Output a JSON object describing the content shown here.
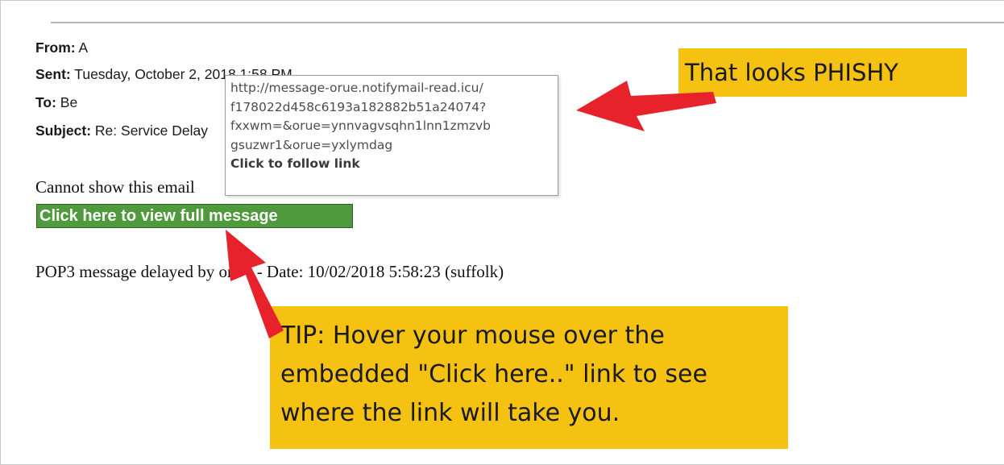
{
  "email": {
    "header": {
      "from_label": "From:",
      "from_value": "A",
      "sent_label": "Sent:",
      "sent_value": "Tuesday, October 2, 2018 1:58 PM",
      "to_label": "To:",
      "to_value": "Be",
      "subject_label": "Subject:",
      "subject_value": "Re: Service Delay"
    },
    "body_notice": "Cannot show this email",
    "link_label": "Click here to view full message",
    "footer_line": "POP3 message delayed by orUe - Date: 10/02/2018 5:58:23 (suffolk)"
  },
  "tooltip": {
    "url_lines": [
      "http://message-orue.notifymail-read.icu/",
      "f178022d458c6193a182882b51a24074?",
      "fxxwm=&orue=ynnvagvsqhn1lnn1zmzvb",
      "gsuzwr1&orue=yxlymdag"
    ],
    "follow_text": "Click to follow link"
  },
  "annotations": {
    "phishy_label": "That looks PHISHY",
    "tip_lines": [
      "TIP: Hover your mouse over the",
      "embedded \"Click here..\" link to see",
      "where the link will take you."
    ]
  },
  "colors": {
    "callout_bg": "#f5c211",
    "link_bg": "#4f9a3c",
    "arrow": "#e8222b"
  }
}
